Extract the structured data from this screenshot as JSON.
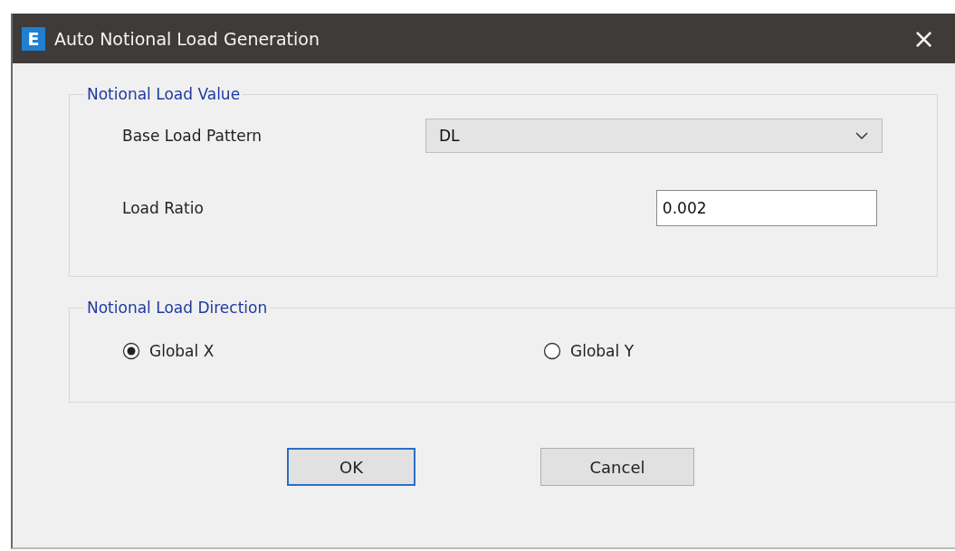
{
  "window": {
    "title": "Auto Notional Load Generation",
    "close": "×",
    "app_badge": "E"
  },
  "notional_load_value": {
    "legend": "Notional Load Value",
    "base_load_pattern": {
      "label": "Base Load Pattern",
      "value": "DL"
    },
    "load_ratio": {
      "label": "Load Ratio",
      "value": "0.002"
    }
  },
  "notional_load_direction": {
    "legend": "Notional Load Direction",
    "options": [
      {
        "label": "Global X",
        "selected": true
      },
      {
        "label": "Global Y",
        "selected": false
      }
    ]
  },
  "buttons": [
    {
      "label": "OK",
      "focused": true
    },
    {
      "label": "Cancel",
      "focused": false
    }
  ]
}
